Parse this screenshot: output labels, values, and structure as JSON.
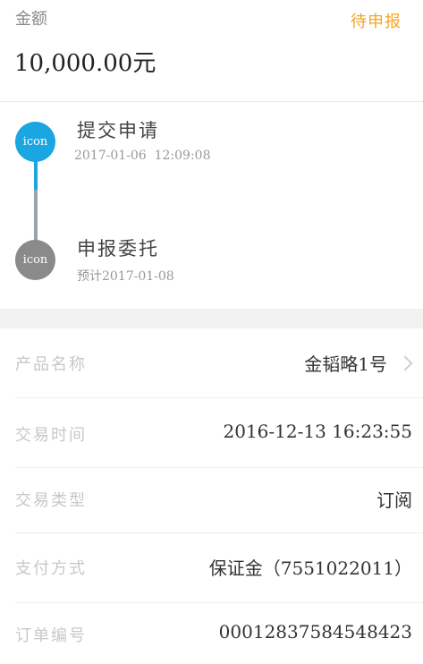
{
  "order": {
    "amount_label": "金额",
    "amount": "10,000.00元",
    "status": "待申报"
  },
  "progress": {
    "steps": [
      {
        "icon_text": "icon",
        "icon_name": "step-submit-icon",
        "title": "提交申请",
        "subtitle": "2017-01-06  12:09:08",
        "state": "active",
        "color": "#1aa6e0"
      },
      {
        "icon_text": "icon",
        "icon_name": "step-delegate-icon",
        "title": "申报委托",
        "subtitle": "预计2017-01-08",
        "state": "pending",
        "color": "#8a8a8a"
      }
    ]
  },
  "details": {
    "rows": [
      {
        "label": "产品名称",
        "value": "金韬略1号",
        "has_arrow": true
      },
      {
        "label": "交易时间",
        "value": "2016-12-13 16:23:55",
        "has_arrow": false
      },
      {
        "label": "交易类型",
        "value": "订阅",
        "has_arrow": false
      },
      {
        "label": "支付方式",
        "value": "保证金（7551022011）",
        "has_arrow": false
      },
      {
        "label": "订单编号",
        "value": "00012837584548423",
        "has_arrow": false
      }
    ]
  },
  "colors": {
    "status": "#f5a623",
    "active_step": "#1aa6e0",
    "pending_step": "#8a8a8a"
  }
}
